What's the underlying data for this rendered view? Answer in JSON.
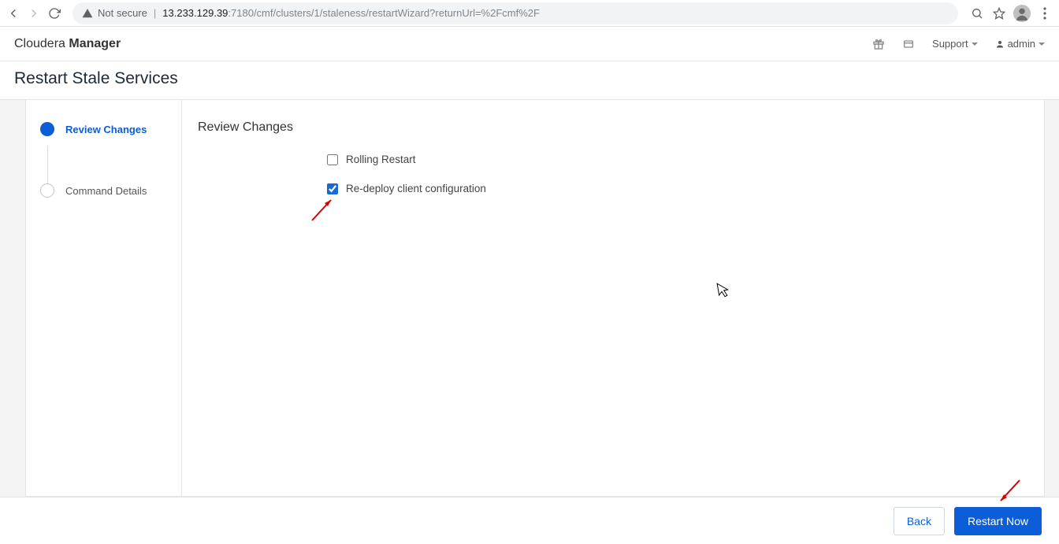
{
  "browser": {
    "not_secure_label": "Not secure",
    "url_host": "13.233.129.39",
    "url_path": ":7180/cmf/clusters/1/staleness/restartWizard?returnUrl=%2Fcmf%2F"
  },
  "header": {
    "brand_first": "Cloudera ",
    "brand_bold": "Manager",
    "support_label": "Support",
    "user_label": "admin"
  },
  "page": {
    "title": "Restart Stale Services"
  },
  "wizard": {
    "steps": [
      {
        "label": "Review Changes",
        "active": true
      },
      {
        "label": "Command Details",
        "active": false
      }
    ],
    "content_heading": "Review Changes",
    "options": {
      "rolling_restart": {
        "label": "Rolling Restart",
        "checked": false
      },
      "redeploy_client": {
        "label": "Re-deploy client configuration",
        "checked": true
      }
    }
  },
  "footer": {
    "back_label": "Back",
    "restart_label": "Restart Now"
  }
}
